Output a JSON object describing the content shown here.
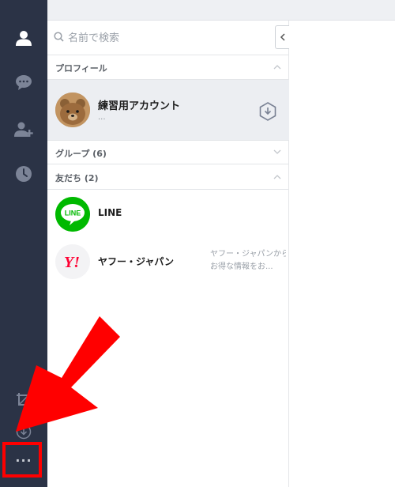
{
  "search": {
    "placeholder": "名前で検索"
  },
  "sidebar": {
    "items": [
      {
        "name": "friends-icon"
      },
      {
        "name": "chat-icon"
      },
      {
        "name": "add-friend-icon"
      },
      {
        "name": "timeline-icon"
      }
    ],
    "bottom": [
      {
        "name": "crop-icon"
      },
      {
        "name": "download-icon"
      },
      {
        "name": "more-icon",
        "label": "···"
      }
    ]
  },
  "sections": {
    "profile": "プロフィール",
    "groups": "グループ (6)",
    "friends": "友だち (2)"
  },
  "profile": {
    "name": "練習用アカウント",
    "status": "..."
  },
  "friends": [
    {
      "name": "LINE",
      "logo_text": "LINE",
      "message_line1": "",
      "message_line2": ""
    },
    {
      "name": "ヤフー・ジャパン",
      "logo_text": "Y!",
      "message_line1": "ヤフー・ジャパンから",
      "message_line2": "お得な情報をお..."
    }
  ],
  "colors": {
    "sidebar": "#2b3346",
    "line_green": "#00b900",
    "yahoo_red": "#ff0033",
    "annotation_red": "#ff0000"
  }
}
